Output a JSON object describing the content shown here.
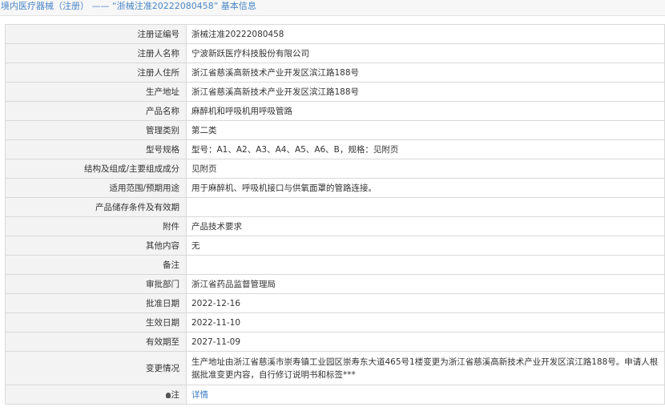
{
  "header": {
    "category": "境内医疗器械（注册）",
    "dash": "——",
    "record": "“浙械注准20222080458”",
    "suffix": "基本信息"
  },
  "rows": [
    {
      "label": "注册证编号",
      "value": "浙械注准20222080458"
    },
    {
      "label": "注册人名称",
      "value": "宁波新跃医疗科技股份有限公司"
    },
    {
      "label": "注册人住所",
      "value": "浙江省慈溪高新技术产业开发区滨江路188号"
    },
    {
      "label": "生产地址",
      "value": "浙江省慈溪高新技术产业开发区滨江路188号"
    },
    {
      "label": "产品名称",
      "value": "麻醉机和呼吸机用呼吸管路"
    },
    {
      "label": "管理类别",
      "value": "第二类"
    },
    {
      "label": "型号规格",
      "value": "型号：A1、A2、A3、A4、A5、A6、B，规格：见附页"
    },
    {
      "label": "结构及组成/主要组成成分",
      "value": "见附页"
    },
    {
      "label": "适用范围/预期用途",
      "value": "用于麻醉机、呼吸机接口与供氧面罩的管路连接。"
    },
    {
      "label": "产品储存条件及有效期",
      "value": ""
    },
    {
      "label": "附件",
      "value": "产品技术要求"
    },
    {
      "label": "其他内容",
      "value": "无"
    },
    {
      "label": "备注",
      "value": ""
    },
    {
      "label": "审批部门",
      "value": "浙江省药品监督管理局"
    },
    {
      "label": "批准日期",
      "value": "2022-12-16"
    },
    {
      "label": "生效日期",
      "value": "2022-11-10"
    },
    {
      "label": "有效期至",
      "value": "2027-11-09"
    },
    {
      "label": "变更情况",
      "value": "生产地址由浙江省慈溪市崇寿镇工业园区崇寿东大道465号1楼变更为浙江省慈溪高新技术产业开发区滨江路188号。申请人根据批准变更内容，自行修订说明书和标签***"
    }
  ],
  "note": {
    "label": "注",
    "icon": "lightbulb-icon",
    "link": "详情"
  },
  "colors": {
    "label_bg": "#f3f3f3",
    "border": "#d9d9d9",
    "link": "#3c7cc4"
  }
}
